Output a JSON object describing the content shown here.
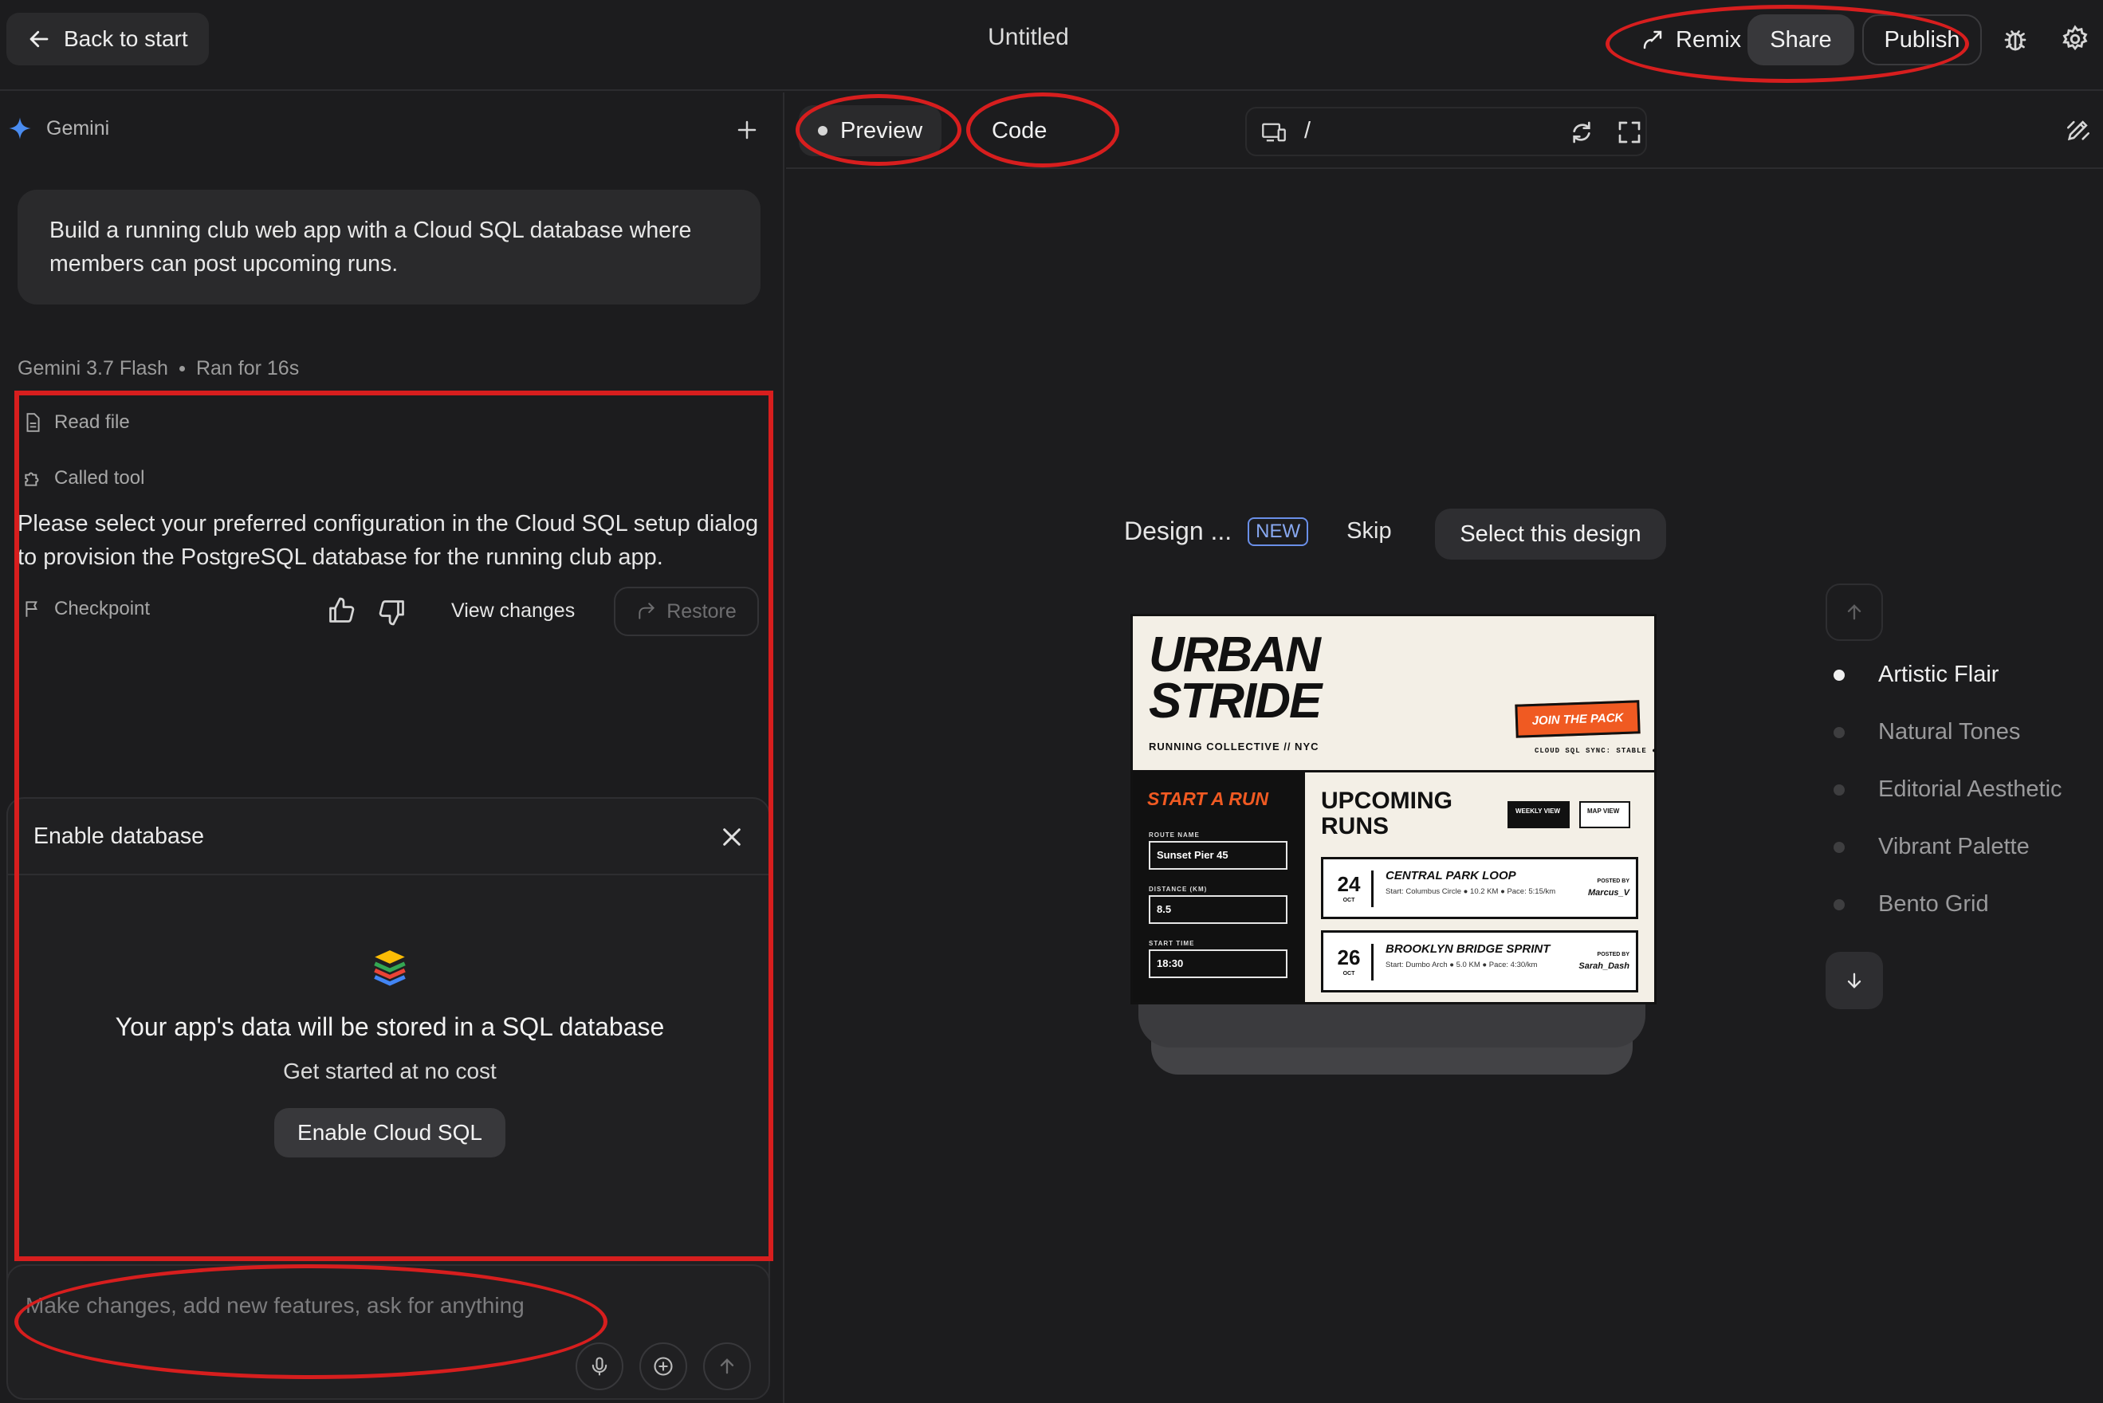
{
  "topbar": {
    "back_label": "Back to start",
    "title": "Untitled",
    "remix_label": "Remix",
    "share_label": "Share",
    "publish_label": "Publish"
  },
  "left": {
    "model_name": "Gemini",
    "prompt": "Build a running club web app with a Cloud SQL database where members can post upcoming runs.",
    "meta": {
      "model": "Gemini 3.7 Flash",
      "duration": "Ran for 16s"
    },
    "steps": [
      "Read file",
      "Called tool"
    ],
    "agent_message": "Please select your preferred configuration in the Cloud SQL setup dialog to provision the PostgreSQL database for the running club app.",
    "checkpoint_label": "Checkpoint",
    "view_changes_label": "View changes",
    "restore_label": "Restore",
    "db_card": {
      "title": "Enable database",
      "headline": "Your app's data will be stored in a SQL database",
      "subtext": "Get started at no cost",
      "button": "Enable Cloud SQL"
    },
    "composer": {
      "placeholder": "Make changes, add new features, ask for anything"
    }
  },
  "right": {
    "tabs": {
      "preview": "Preview",
      "code": "Code"
    },
    "url_path": "/",
    "design_picker": {
      "label": "Design ...",
      "badge": "NEW",
      "skip": "Skip",
      "select": "Select this design",
      "options": [
        "Artistic Flair",
        "Natural Tones",
        "Editorial Aesthetic",
        "Vibrant Palette",
        "Bento Grid"
      ],
      "selected_index": 0
    },
    "preview_card": {
      "brand_line1": "URBAN",
      "brand_line2": "STRIDE",
      "brand_sub": "RUNNING COLLECTIVE // NYC",
      "join": "JOIN THE PACK",
      "sync": "CLOUD SQL SYNC: STABLE ●",
      "start_run": "START A RUN",
      "fields": [
        {
          "label": "ROUTE NAME",
          "value": "Sunset Pier 45"
        },
        {
          "label": "DISTANCE (KM)",
          "value": "8.5"
        },
        {
          "label": "START TIME",
          "value": "18:30"
        }
      ],
      "upcoming": "UPCOMING RUNS",
      "weekly": "WEEKLY VIEW",
      "map": "MAP VIEW",
      "runs": [
        {
          "day": "24",
          "month": "OCT",
          "name": "CENTRAL PARK LOOP",
          "detail": "Start: Columbus Circle ● 10.2 KM ● Pace: 5:15/km",
          "posted_label": "POSTED BY",
          "poster": "Marcus_V"
        },
        {
          "day": "26",
          "month": "OCT",
          "name": "BROOKLYN BRIDGE SPRINT",
          "detail": "Start: Dumbo Arch ● 5.0 KM ● Pace: 4:30/km",
          "posted_label": "POSTED BY",
          "poster": "Sarah_Dash"
        }
      ]
    }
  },
  "colors": {
    "accent_orange": "#f05a22",
    "annotation_red": "#d71e1e",
    "badge_blue": "#88a9f2"
  }
}
